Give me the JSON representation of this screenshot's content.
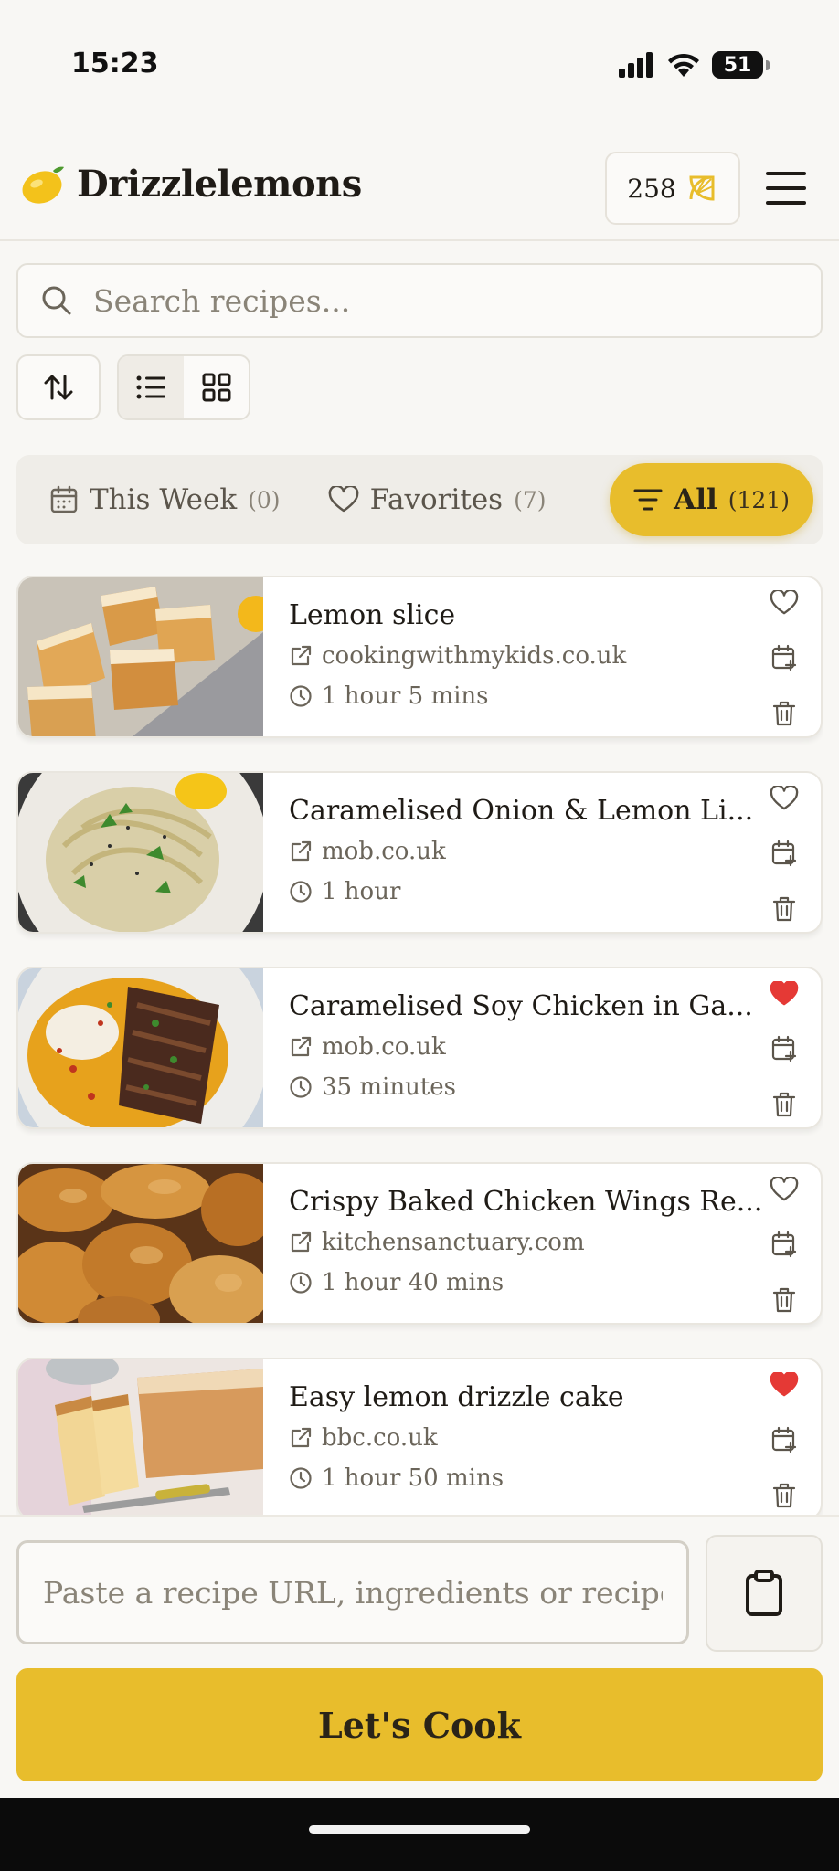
{
  "status_bar": {
    "time": "15:23",
    "battery": "51",
    "icons": [
      "signal-icon",
      "wifi-icon",
      "battery-icon"
    ]
  },
  "header": {
    "logo_icon": "lemon-emoji",
    "title": "Drizzlelemons",
    "points": "258",
    "points_icon": "lemon-slice-icon",
    "menu_icon": "hamburger-menu-icon"
  },
  "search": {
    "placeholder": "Search recipes...",
    "icon": "search-icon"
  },
  "toolbar": {
    "sort_icon": "sort-arrows-icon",
    "view_modes": [
      "list",
      "grid"
    ],
    "active_view": "list"
  },
  "tabs": [
    {
      "label": "This Week",
      "count": "(0)",
      "icon": "calendar-icon"
    },
    {
      "label": "Favorites",
      "count": "(7)",
      "icon": "heart-icon"
    },
    {
      "label": "All",
      "count": "(121)",
      "icon": "filter-icon",
      "active": true
    }
  ],
  "recipes": [
    {
      "title": "Lemon slice",
      "source": "cookingwithmykids.co.uk",
      "time": "1 hour 5 mins",
      "favorite": false
    },
    {
      "title": "Caramelised Onion & Lemon Li...",
      "source": "mob.co.uk",
      "time": "1 hour",
      "favorite": false
    },
    {
      "title": "Caramelised Soy Chicken in Ga...",
      "source": "mob.co.uk",
      "time": "35 minutes",
      "favorite": true
    },
    {
      "title": "Crispy Baked Chicken Wings Re...",
      "source": "kitchensanctuary.com",
      "time": "1 hour 40 mins",
      "favorite": false
    },
    {
      "title": "Easy lemon drizzle cake",
      "source": "bbc.co.uk",
      "time": "1 hour 50 mins",
      "favorite": true
    }
  ],
  "composer": {
    "placeholder": "Paste a recipe URL, ingredients or recipe",
    "paste_icon": "clipboard-icon",
    "cta": "Let's Cook"
  },
  "colors": {
    "accent": "#E8BD2C",
    "background": "#F8F7F4",
    "favorite": "#E53935",
    "text": "#1F1B16"
  }
}
